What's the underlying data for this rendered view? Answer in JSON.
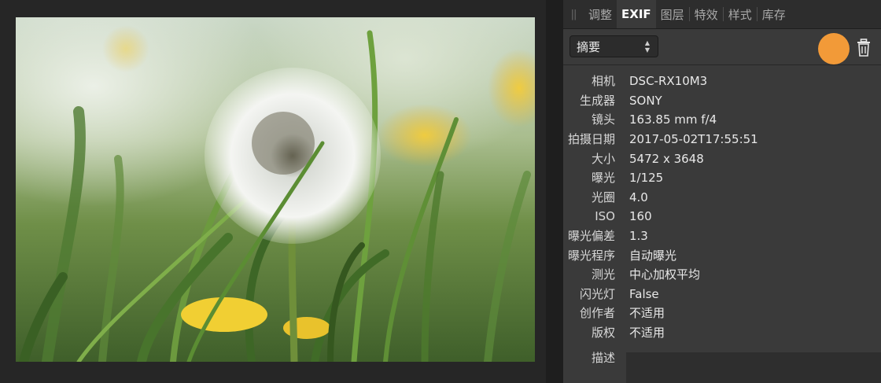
{
  "panel": {
    "tabs": [
      {
        "label": "调整",
        "active": false
      },
      {
        "label": "EXIF",
        "active": true
      },
      {
        "label": "图层",
        "active": false
      },
      {
        "label": "特效",
        "active": false
      },
      {
        "label": "样式",
        "active": false
      },
      {
        "label": "库存",
        "active": false
      }
    ],
    "mode_select": {
      "value": "摘要"
    },
    "accent_color": "#f29a38"
  },
  "exif": {
    "rows": [
      {
        "key": "相机",
        "value": "DSC-RX10M3"
      },
      {
        "key": "生成器",
        "value": "SONY"
      },
      {
        "key": "镜头",
        "value": "163.85 mm f/4"
      },
      {
        "key": "拍摄日期",
        "value": "2017-05-02T17:55:51"
      },
      {
        "key": "大小",
        "value": "5472 x 3648"
      },
      {
        "key": "曝光",
        "value": "1/125"
      },
      {
        "key": "光圈",
        "value": "4.0"
      },
      {
        "key": "ISO",
        "value": "160"
      },
      {
        "key": "曝光偏差",
        "value": "1.3"
      },
      {
        "key": "曝光程序",
        "value": "自动曝光"
      },
      {
        "key": "测光",
        "value": "中心加权平均"
      },
      {
        "key": "闪光灯",
        "value": "False"
      },
      {
        "key": "创作者",
        "value": "不适用"
      },
      {
        "key": "版权",
        "value": "不适用"
      }
    ],
    "description_label": "描述"
  }
}
